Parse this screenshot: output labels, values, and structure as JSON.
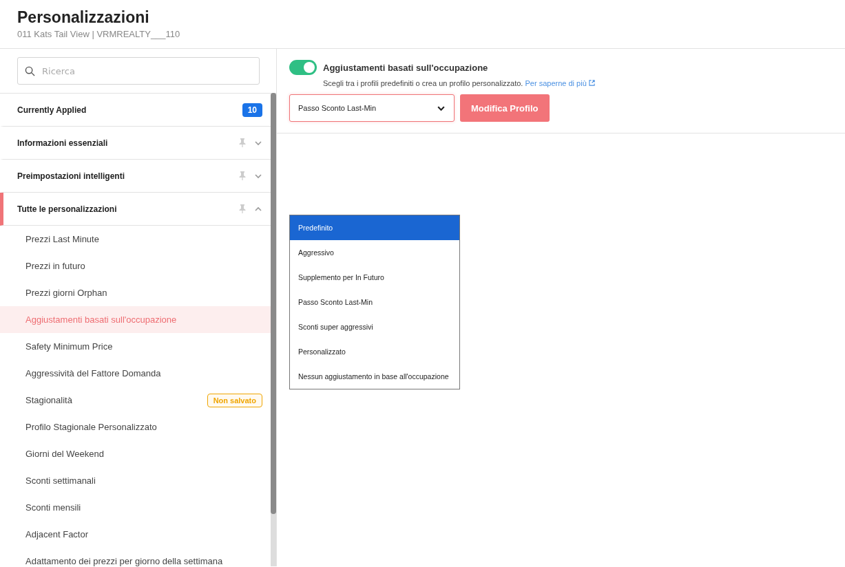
{
  "header": {
    "title": "Personalizzazioni",
    "subtitle": "011 Kats Tail View | VRMREALTY___110"
  },
  "sidebar": {
    "search": {
      "placeholder": "Ricerca"
    },
    "sections": [
      {
        "kind": "summary",
        "label": "Currently Applied",
        "count": "10",
        "selected": false
      },
      {
        "kind": "group",
        "label": "Informazioni essenziali",
        "selected": false,
        "expanded": false
      },
      {
        "kind": "group",
        "label": "Preimpostazioni intelligenti",
        "selected": false,
        "expanded": false
      },
      {
        "kind": "group",
        "label": "Tutte le personalizzazioni",
        "selected": true,
        "expanded": true,
        "children": [
          {
            "label": "Prezzi Last Minute",
            "selected": false
          },
          {
            "label": "Prezzi in futuro",
            "selected": false
          },
          {
            "label": "Prezzi giorni Orphan",
            "selected": false
          },
          {
            "label": "Aggiustamenti basati sull'occupazione",
            "selected": true
          },
          {
            "label": "Safety Minimum Price",
            "selected": false
          },
          {
            "label": "Aggressività del Fattore Domanda",
            "selected": false
          },
          {
            "label": "Stagionalità",
            "selected": false,
            "badge": "Non salvato"
          },
          {
            "label": "Profilo Stagionale Personalizzato",
            "selected": false
          },
          {
            "label": "Giorni del Weekend",
            "selected": false
          },
          {
            "label": "Sconti settimanali",
            "selected": false
          },
          {
            "label": "Sconti mensili",
            "selected": false
          },
          {
            "label": "Adjacent Factor",
            "selected": false
          },
          {
            "label": "Adattamento dei prezzi per giorno della settimana",
            "selected": false
          }
        ]
      }
    ]
  },
  "panel": {
    "toggle": {
      "label": "Aggiustamenti basati sull'occupazione",
      "on": true
    },
    "description": "Scegli tra i profili predefiniti o crea un profilo personalizzato.",
    "link": "Per saperne di più",
    "select": {
      "value": "Passo Sconto Last-Min"
    },
    "button": "Modifica Profilo",
    "options": [
      {
        "label": "Predefinito",
        "selected": true
      },
      {
        "label": "Aggressivo",
        "selected": false
      },
      {
        "label": "Supplemento per In Futuro",
        "selected": false
      },
      {
        "label": "Passo Sconto Last-Min",
        "selected": false
      },
      {
        "label": "Sconti super aggressivi",
        "selected": false
      },
      {
        "label": "Personalizzato",
        "selected": false
      },
      {
        "label": "Nessun aggiustamento in base all'occupazione",
        "selected": false
      }
    ]
  }
}
